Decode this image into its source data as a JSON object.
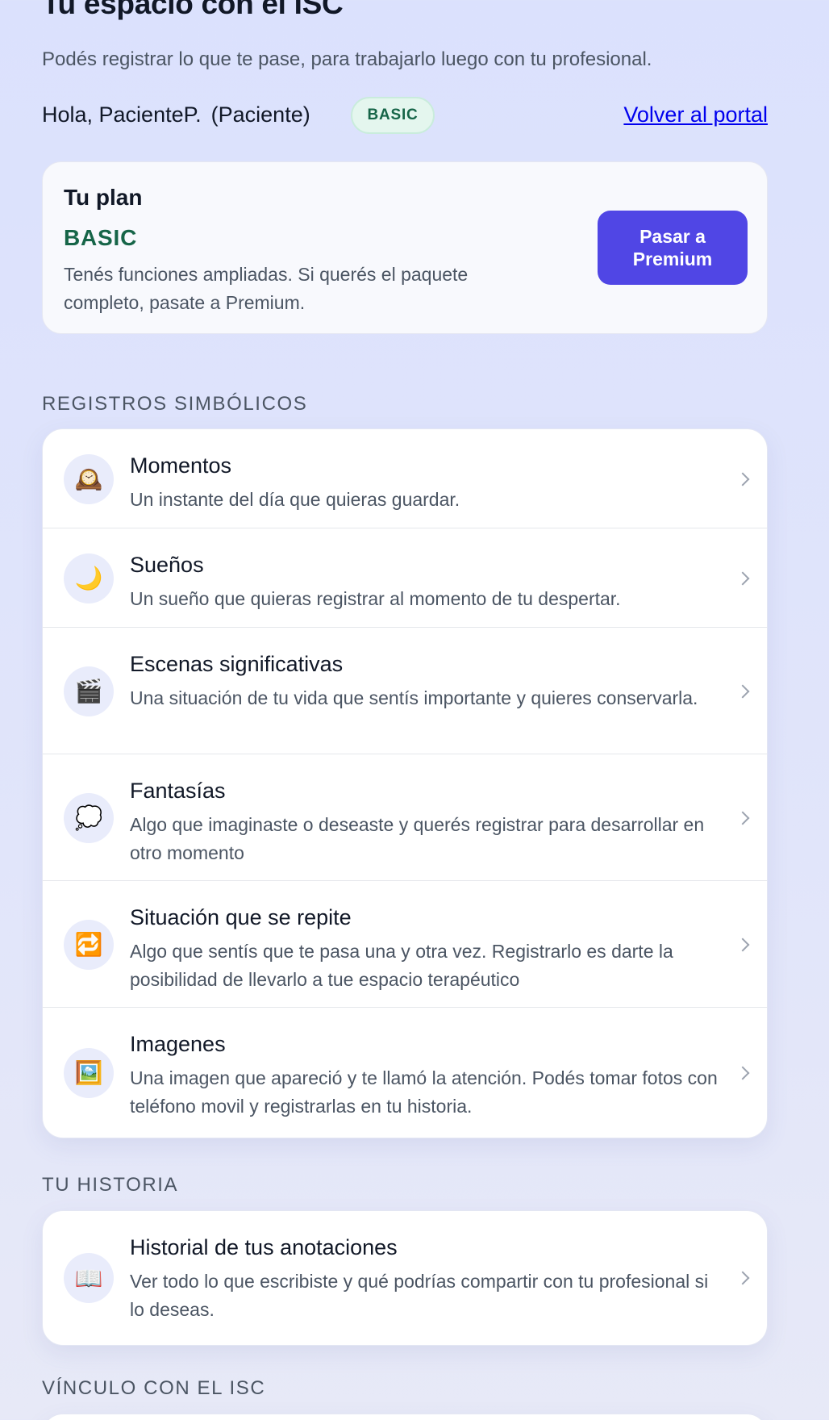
{
  "header": {
    "title": "Tu espacio con el ISC",
    "subtitle": "Podés registrar lo que te pase, para trabajarlo luego con tu profesional.",
    "greeting": "Hola, PacienteP.",
    "role": "(Paciente)",
    "badge": "BASIC",
    "portal_link": "Volver al portal"
  },
  "plan": {
    "heading": "Tu plan",
    "name": "BASIC",
    "description": "Tenés funciones ampliadas. Si querés el paquete completo, pasate a Premium.",
    "button_label": "Pasar a Premium"
  },
  "sections": {
    "registros_label": "REGISTROS SIMBÓLICOS",
    "historia_label": "TU HISTORIA",
    "vinculo_label": "VÍNCULO CON EL ISC"
  },
  "registros": [
    {
      "icon": "mantelpiece-clock-icon",
      "glyph": "🕰️",
      "title": "Momentos",
      "desc": "Un instante del día que quieras guardar."
    },
    {
      "icon": "crescent-moon-icon",
      "glyph": "🌙",
      "title": "Sueños",
      "desc": "Un sueño que quieras registrar al momento de tu despertar."
    },
    {
      "icon": "clapper-board-icon",
      "glyph": "🎬",
      "title": "Escenas significativas",
      "desc": "Una situación de tu vida que sentís importante y quieres conservarla."
    },
    {
      "icon": "thought-balloon-icon",
      "glyph": "💭",
      "title": "Fantasías",
      "desc": "Algo que imaginaste o deseaste y querés registrar para desarrollar en otro momento"
    },
    {
      "icon": "repeat-arrows-icon",
      "glyph": "🔁",
      "title": "Situación que se repite",
      "desc": "Algo que sentís que te pasa una y otra vez. Registrarlo es darte la posibilidad de llevarlo a tue espacio terapéutico"
    },
    {
      "icon": "framed-picture-icon",
      "glyph": "🖼️",
      "title": "Imagenes",
      "desc": "Una imagen que apareció y te llamó la atención. Podés tomar fotos con teléfono movil y registrarlas en tu historia."
    }
  ],
  "historia": [
    {
      "icon": "open-book-icon",
      "glyph": "📖",
      "title": "Historial de tus anotaciones",
      "desc": "Ver todo lo que escribiste y qué podrías compartir con tu profesional si lo deseas."
    }
  ],
  "colors": {
    "accent": "#5046e5",
    "plan_green": "#166548",
    "badge_bg": "#e4f6ee",
    "link": "#0000ee",
    "page_bg": "#dbe1fd"
  }
}
